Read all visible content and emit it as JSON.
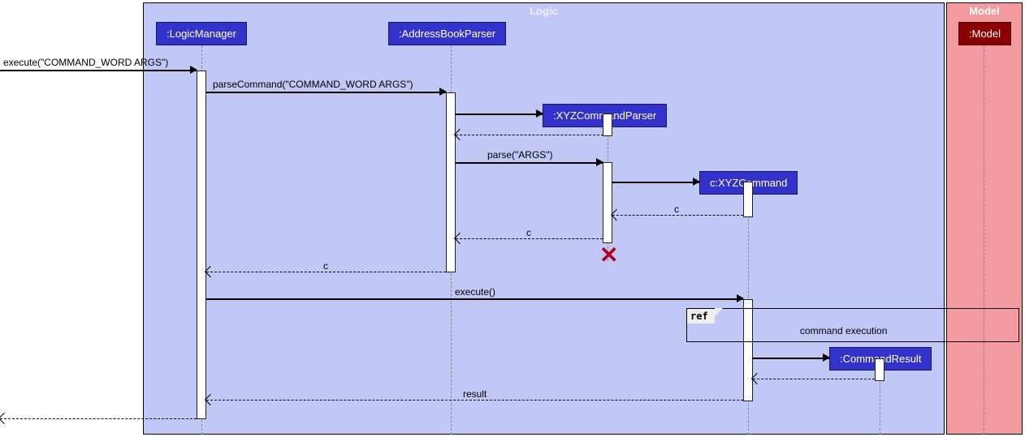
{
  "regions": {
    "logic": {
      "label": "Logic",
      "bgcolor": "#c2c8f6",
      "labelcolor": "#eef0fe"
    },
    "model": {
      "label": "Model",
      "bgcolor": "#f39aa0",
      "labelcolor": "#fff"
    }
  },
  "participants": {
    "logicManager": {
      "label": ":LogicManager"
    },
    "addressBookParser": {
      "label": ":AddressBookParser"
    },
    "xyzCommandParser": {
      "label": ":XYZCommandParser"
    },
    "xyzCommand": {
      "label": "c:XYZCommand"
    },
    "commandResult": {
      "label": ":CommandResult"
    },
    "model": {
      "label": ":Model"
    }
  },
  "messages": {
    "m1": "execute(\"COMMAND_WORD ARGS\")",
    "m2": "parseCommand(\"COMMAND_WORD ARGS\")",
    "m3": "parse(\"ARGS\")",
    "m4": "c",
    "m5": "c",
    "m6": "c",
    "m7": "execute()",
    "m8": "command execution",
    "m9": "result",
    "ref": "ref"
  }
}
